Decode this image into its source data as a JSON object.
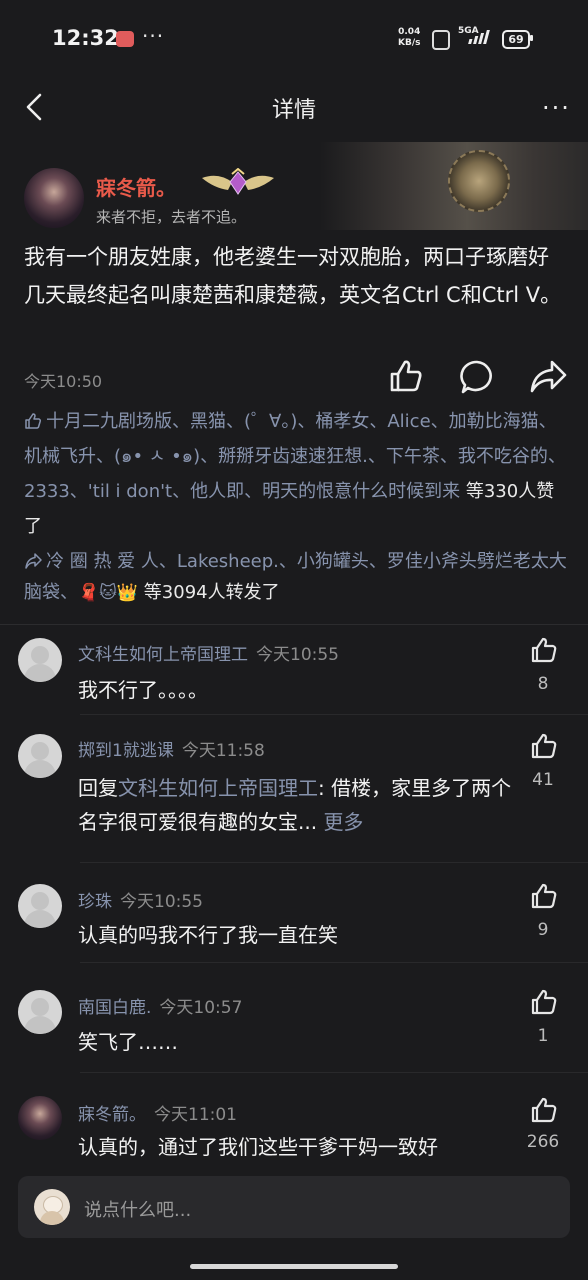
{
  "status_bar": {
    "time": "12:32",
    "dots": "···",
    "net_speed_value": "0.04",
    "net_speed_unit": "KB/s",
    "signal_label": "5GA",
    "battery": "69"
  },
  "header": {
    "title": "详情",
    "more": "···"
  },
  "post": {
    "author_name": "寐冬箭。",
    "author_signature": "来者不拒，去者不追。",
    "text": "我有一个朋友姓康，他老婆生一对双胞胎，两口子琢磨好几天最终起名叫康楚茜和康楚薇，英文名Ctrl C和Ctrl V。",
    "time": "今天10:50",
    "likes_names": "十月二九剧场版、黑猫、(゜∀。)、桶孝女、Alice、加勒比海猫、机械飞升、(๑• ㅅ •๑)、掰掰牙齿速速狂想.、下午茶、我不吃谷的、2333、'til i don't、他人即、明天的恨意什么时候到来",
    "likes_tail": "等330人赞了",
    "reposts_names": "冷 圈 热 爱 人、Lakesheep.、小狗罐头、罗佳小斧头劈烂老太大脑袋、",
    "reposts_emojis": "🧣🐱👑",
    "reposts_tail": "等3094人转发了"
  },
  "comments": [
    {
      "name": "文科生如何上帝国理工",
      "time": "今天10:55",
      "text": "我不行了。。。。",
      "likes": "8"
    },
    {
      "name": "掷到1就逃课",
      "time": "今天11:58",
      "reply_prefix": "回复",
      "reply_to": "文科生如何上帝国理工",
      "text": ": 借楼，家里多了两个名字很可爱很有趣的女宝...",
      "more": "更多",
      "likes": "41"
    },
    {
      "name": "珍珠",
      "time": "今天10:55",
      "text": "认真的吗我不行了我一直在笑",
      "likes": "9"
    },
    {
      "name": "南国白鹿.",
      "time": "今天10:57",
      "text": "笑飞了……",
      "likes": "1"
    },
    {
      "name": "寐冬箭。",
      "time": "今天11:01",
      "text": "认真的，通过了我们这些干爹干妈一致好",
      "likes": "266"
    }
  ],
  "input": {
    "placeholder": "说点什么吧..."
  },
  "colors": {
    "background": "#1b1b1d",
    "author_name": "#e85a4a",
    "link_blue": "#8793ad"
  }
}
